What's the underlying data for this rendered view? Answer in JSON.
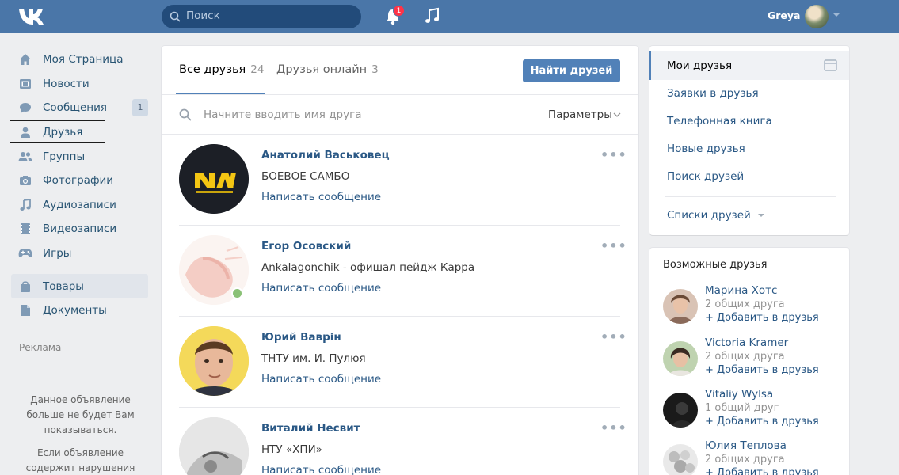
{
  "header": {
    "search_placeholder": "Поиск",
    "notifications_count": "1",
    "user_name": "Greya"
  },
  "left_menu": {
    "items": [
      {
        "label": "Моя Страница",
        "icon": "home-icon"
      },
      {
        "label": "Новости",
        "icon": "news-icon"
      },
      {
        "label": "Сообщения",
        "icon": "messages-icon",
        "badge": "1"
      },
      {
        "label": "Друзья",
        "icon": "friends-icon"
      },
      {
        "label": "Группы",
        "icon": "groups-icon"
      },
      {
        "label": "Фотографии",
        "icon": "camera-icon"
      },
      {
        "label": "Аудиозаписи",
        "icon": "music-icon"
      },
      {
        "label": "Видеозаписи",
        "icon": "video-icon"
      },
      {
        "label": "Игры",
        "icon": "gamepad-icon"
      },
      {
        "label": "Товары",
        "icon": "bag-icon"
      },
      {
        "label": "Документы",
        "icon": "document-icon"
      }
    ],
    "ads_label": "Реклама",
    "ad_notice": "Данное объявление больше не будет Вам показываться.",
    "ad_notice2": "Если объявление содержит нарушения"
  },
  "main": {
    "tabs": [
      {
        "label": "Все друзья",
        "count": "24"
      },
      {
        "label": "Друзья онлайн",
        "count": "3"
      }
    ],
    "find_button": "Найти друзей",
    "search_placeholder": "Начните вводить имя друга",
    "params_label": "Параметры",
    "friends": [
      {
        "name": "Анатолий Васьковец",
        "subtitle": "БОЕВОЕ САМБО",
        "action": "Написать сообщение",
        "online": false
      },
      {
        "name": "Егор Осовский",
        "subtitle": "Ankalagonchik - офишал пейдж Карра",
        "action": "Написать сообщение",
        "online": true
      },
      {
        "name": "Юрий Ваврін",
        "subtitle": "ТНТУ им. И. Пулюя",
        "action": "Написать сообщение",
        "online": false
      },
      {
        "name": "Виталий Несвит",
        "subtitle": "НТУ «ХПИ»",
        "action": "Написать сообщение",
        "online": false
      }
    ],
    "more_glyph": "•••"
  },
  "right_menu": {
    "selected": "Мои друзья",
    "items": [
      "Заявки в друзья",
      "Телефонная книга",
      "Новые друзья",
      "Поиск друзей"
    ],
    "lists_label": "Списки друзей"
  },
  "possible_friends": {
    "title": "Возможные друзья",
    "add_label": "+ Добавить в друзья",
    "people": [
      {
        "name": "Марина Хотс",
        "common": "2 общих друга"
      },
      {
        "name": "Victoria Kramer",
        "common": "2 общих друга"
      },
      {
        "name": "Vitaliy Wylsa",
        "common": "1 общий друг"
      },
      {
        "name": "Юлия Теплова",
        "common": "2 общих друга"
      }
    ]
  },
  "colors": {
    "header": "#4a76a8",
    "accent": "#5181b8",
    "link": "#2a5885",
    "background": "#edeef0",
    "online": "#8ac176",
    "badge": "#ff3347"
  }
}
